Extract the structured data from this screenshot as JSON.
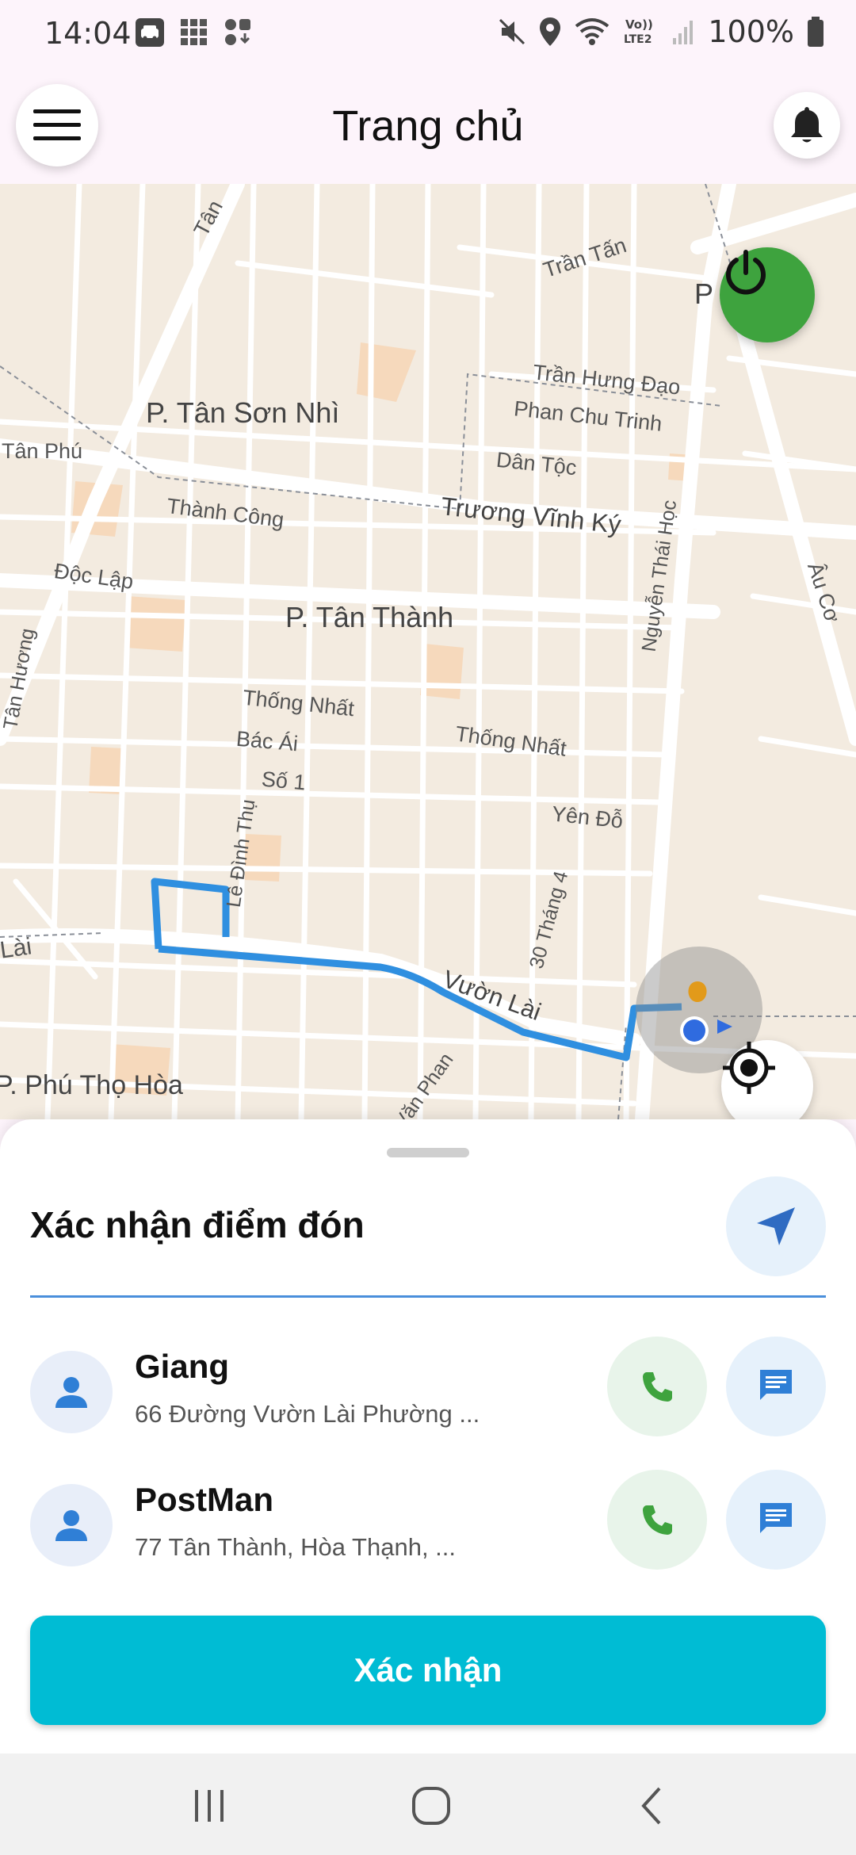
{
  "status_bar": {
    "time": "14:04",
    "battery": "100%",
    "network_label": "VoLTE2",
    "icons_left": [
      "car-app-icon",
      "grid-app-icon",
      "download-app-icon"
    ],
    "icons_right": [
      "mute-icon",
      "location-icon",
      "wifi-icon",
      "volte-icon",
      "signal-icon",
      "battery-icon"
    ]
  },
  "header": {
    "title": "Trang chủ",
    "menu_icon": "hamburger-menu-icon",
    "notification_icon": "bell-icon"
  },
  "map": {
    "labels": {
      "p_tan_son_nhi": "P. Tân Sơn Nhì",
      "p_tan_thanh": "P. Tân Thành",
      "p_phu_tho_hoa": "P. Phú Thọ Hòa",
      "tan_phu": "Tân Phú",
      "tan_top": "Tân",
      "tran_tan": "Trần Tấn",
      "tran_hung_dao": "Trần Hưng Đạo",
      "phan_chu_trinh": "Phan Chu Trinh",
      "dan_toc": "Dân Tộc",
      "truong_vinh_ky": "Trương Vĩnh Ký",
      "thanh_cong": "Thành Công",
      "doc_lap": "Độc Lập",
      "nguyen_thai_hoc": "Nguyễn Thái Học",
      "au_co": "Âu Cơ",
      "thong_nhat_1": "Thống Nhất",
      "thong_nhat_2": "Thống Nhất",
      "bac_ai": "Bác Ái",
      "so_1": "Số 1",
      "yen_do": "Yên Đỗ",
      "le_dinh_thu": "Lê Đình Thụ",
      "thang_30_4": "30 Tháng 4",
      "vuon_lai": "Vườn Lài",
      "lai_left": "Lài",
      "tan_huong": "Tân Hương",
      "van_phan": "Văn Phan",
      "p_right": "P"
    },
    "power_icon": "power-icon",
    "locate_icon": "crosshair-locate-icon"
  },
  "sheet": {
    "title": "Xác nhận điểm đón",
    "nav_icon": "navigation-arrow-icon",
    "contacts": [
      {
        "name": "Giang",
        "address": "66 Đường Vườn Lài Phường ..."
      },
      {
        "name": "PostMan",
        "address": "77 Tân Thành, Hòa Thạnh, ..."
      }
    ],
    "confirm_label": "Xác nhận"
  },
  "colors": {
    "accent": "#00bcd4",
    "route": "#2f8fe0",
    "power": "#3ea33e",
    "call_icon": "#3ea33e",
    "message_icon": "#2f7fd6"
  }
}
